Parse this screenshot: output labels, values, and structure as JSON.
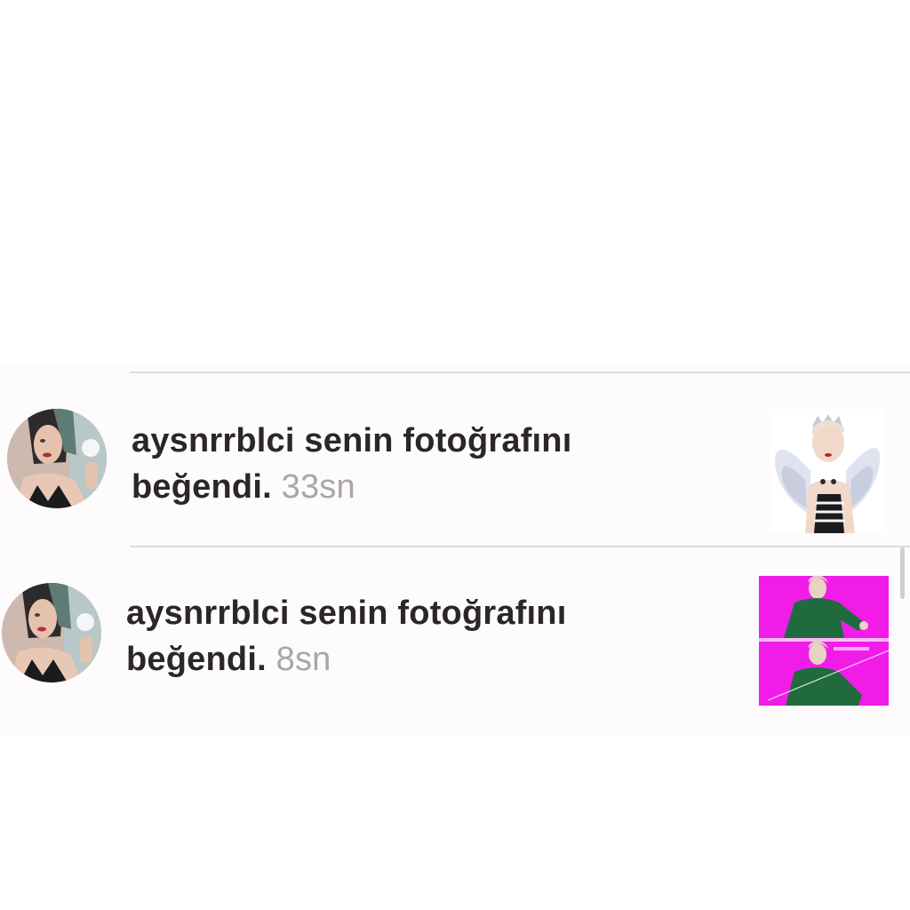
{
  "notifications": [
    {
      "username": "aysnrrblci",
      "message_line1": "senin fotoğrafını",
      "message_line2": "beğendi.",
      "time": "33sn",
      "avatar_icon": "user-avatar-photo",
      "thumbnail_icon": "liked-photo-angel-wings"
    },
    {
      "username": "aysnrrblci",
      "message_line1": "senin fotoğrafını",
      "message_line2": "beğendi.",
      "time": "8sn",
      "avatar_icon": "user-avatar-photo",
      "thumbnail_icon": "liked-photo-pink-collage"
    }
  ],
  "colors": {
    "text": "#2a2629",
    "time": "#a9a5a8",
    "divider": "#dedcdd",
    "thumbnail_pink": "#f21ce8",
    "jacket_green": "#1f6b3e"
  }
}
